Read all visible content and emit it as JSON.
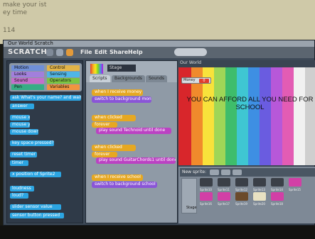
{
  "background_note": {
    "lines": [
      "make your ist",
      "ey time"
    ],
    "left_label": "114"
  },
  "window": {
    "title": "Our World  Scratch"
  },
  "menubar": {
    "logo": "SCRATCH",
    "menus": [
      "File",
      "Edit",
      "Share",
      "Help"
    ]
  },
  "palette": {
    "categories": [
      {
        "label": "Motion",
        "color": "#4a6cd4"
      },
      {
        "label": "Control",
        "color": "#e6a822"
      },
      {
        "label": "Looks",
        "color": "#8a55d7"
      },
      {
        "label": "Sensing",
        "color": "#2ca5e2"
      },
      {
        "label": "Sound",
        "color": "#bb42c3"
      },
      {
        "label": "Operators",
        "color": "#5cb712"
      },
      {
        "label": "Pen",
        "color": "#0e9a6c"
      },
      {
        "label": "Variables",
        "color": "#ee7d16"
      }
    ],
    "blocks": [
      "ask  What's your name?  and wait",
      "answer",
      "mouse x",
      "mouse y",
      "mouse down?",
      "key  space  pressed?",
      "reset timer",
      "timer",
      "x position  of  Sprite2",
      "loudness",
      "loud?",
      "slider  sensor value",
      "sensor  button pressed"
    ]
  },
  "scripts": {
    "sprite_name": "Stage",
    "tabs": [
      "Scripts",
      "Backgrounds",
      "Sounds"
    ],
    "active_tab": "Scripts",
    "blocks": [
      "when I receive  money",
      "switch to background  money",
      "when  clicked",
      "forever",
      "play sound  Technoid  until done",
      "when  clicked",
      "forever",
      "play sound  GuitarChords1  until done",
      "when I receive  school",
      "switch to background  school"
    ]
  },
  "stage": {
    "title": "Our World",
    "message": "YOU CAN AFFORD ALL YOU NEED FOR SCHOOL",
    "money_label": "Money",
    "money_value": "0"
  },
  "sprites": {
    "new_sprite_label": "New sprite:",
    "stage_label": "Stage",
    "items": [
      {
        "name": "Sprite10",
        "color": "#3a3f47"
      },
      {
        "name": "Sprite11",
        "color": "#3a3f47"
      },
      {
        "name": "Sprite12",
        "color": "#3a3f47"
      },
      {
        "name": "Sprite13",
        "color": "#3a3f47"
      },
      {
        "name": "Sprite14",
        "color": "#3a3f47"
      },
      {
        "name": "Sprite15",
        "color": "#d23fa6"
      },
      {
        "name": "Sprite16",
        "color": "#d23fa6"
      },
      {
        "name": "Sprite17",
        "color": "#d23fa6"
      },
      {
        "name": "Sprite18",
        "color": "#d23fa6"
      },
      {
        "name": "Sprite19",
        "color": "#6b4a2a"
      },
      {
        "name": "Sprite20",
        "color": "#e8e1c2"
      }
    ]
  }
}
